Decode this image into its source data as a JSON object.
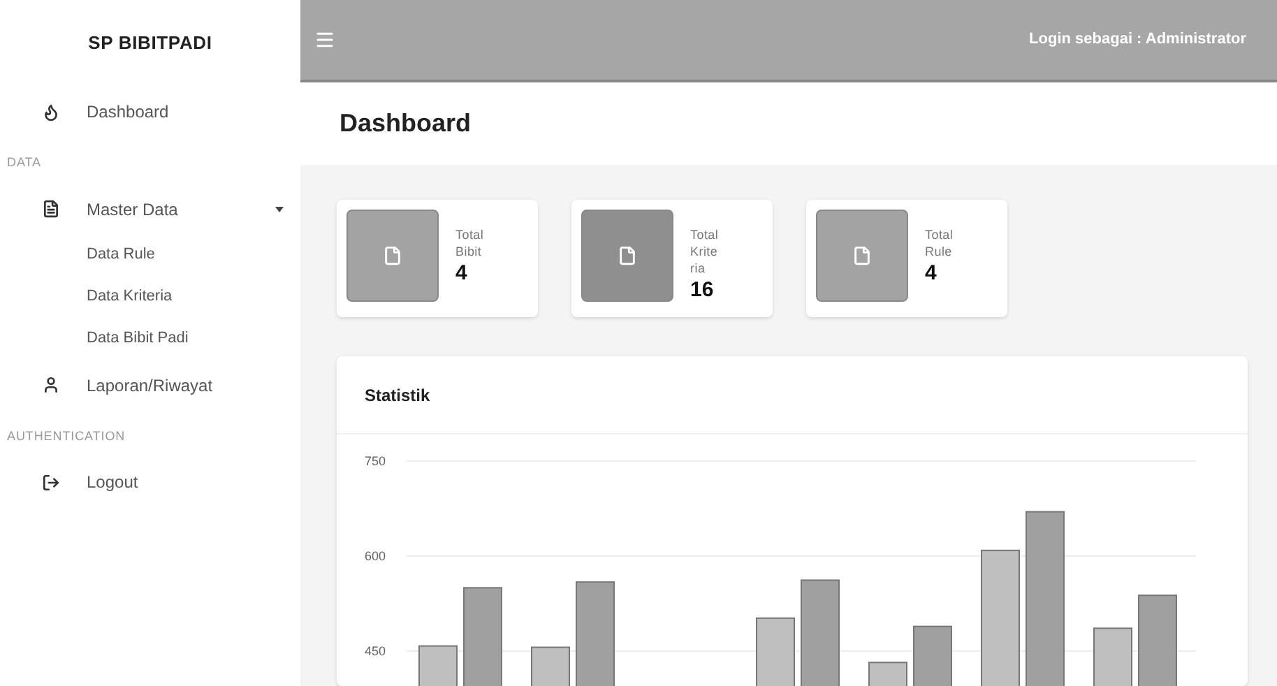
{
  "sidebar": {
    "brand": "SP BIBITPADI",
    "sections": [
      {
        "items": [
          {
            "kind": "dashboard",
            "label": "Dashboard"
          }
        ]
      },
      {
        "heading": "DATA",
        "items": [
          {
            "kind": "dropdown",
            "label": "Master Data",
            "expanded": true,
            "children": [
              {
                "label": "Data Rule"
              },
              {
                "label": "Data Kriteria"
              },
              {
                "label": "Data Bibit Padi"
              }
            ]
          },
          {
            "kind": "report",
            "label": "Laporan/Riwayat"
          }
        ]
      },
      {
        "heading": "AUTHENTICATION",
        "items": [
          {
            "kind": "logout",
            "label": "Logout"
          }
        ]
      }
    ]
  },
  "topbar": {
    "login_text": "Login sebagai : Administrator"
  },
  "page_title": "Dashboard",
  "stat_cards": [
    {
      "label_lines": [
        "Total",
        "Bibit"
      ],
      "value": "4",
      "color": "#a3a3a3"
    },
    {
      "label_lines": [
        "Total",
        "Krite",
        "ria"
      ],
      "value": "16",
      "color": "#8f8f8f"
    },
    {
      "label_lines": [
        "Total",
        "Rule"
      ],
      "value": "4",
      "color": "#a3a3a3"
    }
  ],
  "statistik": {
    "title": "Statistik",
    "chart_data": {
      "type": "bar",
      "ylim": [
        395,
        750
      ],
      "yticks": [
        450,
        600,
        750
      ],
      "series": [
        {
          "color": "#bfbfbf",
          "values": [
            458,
            456,
            null,
            502,
            432,
            609,
            486
          ]
        },
        {
          "color": "#a0a0a0",
          "values": [
            550,
            559,
            null,
            562,
            489,
            670,
            538
          ]
        }
      ]
    }
  }
}
